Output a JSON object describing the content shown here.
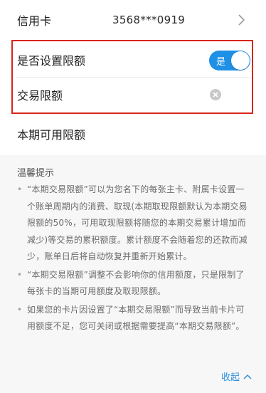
{
  "card": {
    "label": "信用卡",
    "number": "3568***0919"
  },
  "limit_setting": {
    "label": "是否设置限额",
    "toggle_text": "是",
    "toggle_on": true
  },
  "transaction_limit": {
    "label": "交易限额",
    "value": ""
  },
  "available_limit": {
    "label": "本期可用限额"
  },
  "tips": {
    "title": "温馨提示",
    "items": [
      "“本期交易限额”可以为您名下的每张主卡、附属卡设置一个账单周期内的消费、取现(本期取现限额默认为本期交易限额的50%，可用取现限额将随您的本期交易累计增加而减少)等交易的累积额度。累计额度不会随着您的还款而减少，账单日后将自动恢复并重新开始累计。",
      "“本期交易限额”调整不会影响你的信用额度，只是限制了每张卡的当期可用额度及取现限额。",
      "如果您的卡片因设置了“本期交易限额”而导致当前卡片可用额度不足，您可关闭或根据需要提高“本期交易限额”。"
    ],
    "collapse_label": "收起"
  },
  "colors": {
    "accent": "#1e90e6",
    "highlight_border": "#d9251c",
    "link": "#2f8fe0"
  }
}
